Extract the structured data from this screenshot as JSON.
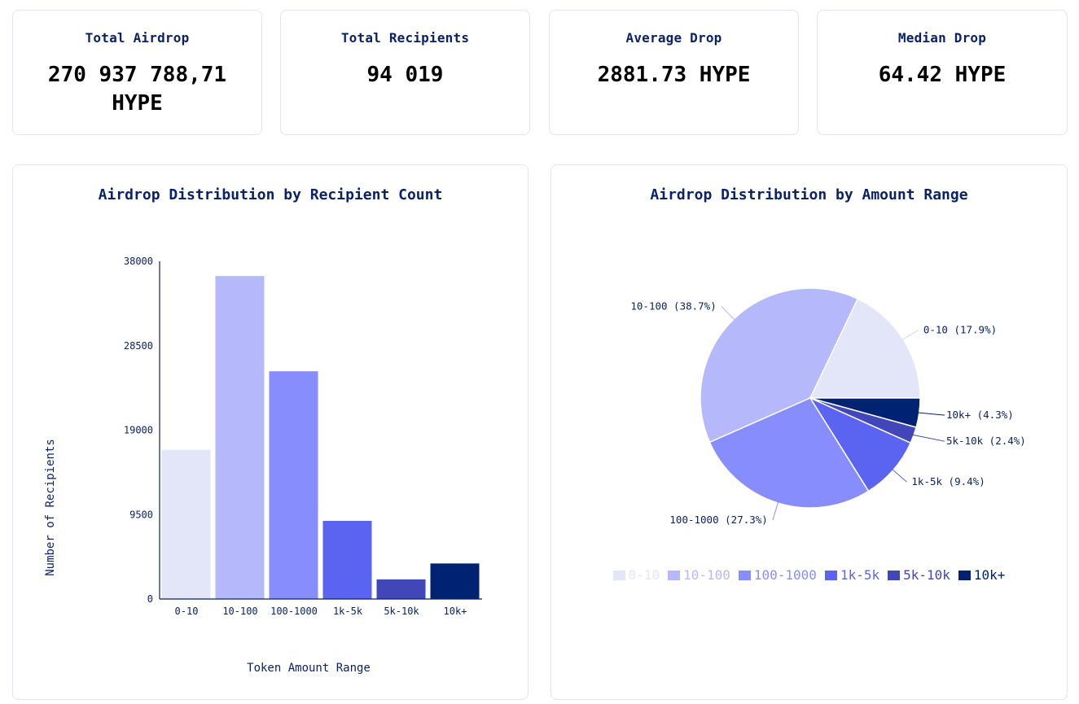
{
  "stats": [
    {
      "label": "Total Airdrop",
      "value": "270 937 788,71 HYPE"
    },
    {
      "label": "Total Recipients",
      "value": "94 019"
    },
    {
      "label": "Average Drop",
      "value": "2881.73 HYPE"
    },
    {
      "label": "Median Drop",
      "value": "64.42 HYPE"
    }
  ],
  "colors": [
    "#e3e5f8",
    "#b6b8fc",
    "#878dfc",
    "#5b64f1",
    "#4146b9",
    "#002272"
  ],
  "chart_data": [
    {
      "type": "bar",
      "title": "Airdrop Distribution by Recipient Count",
      "xlabel": "Token Amount Range",
      "ylabel": "Number of Recipients",
      "categories": [
        "0-10",
        "10-100",
        "100-1000",
        "1k-5k",
        "5k-10k",
        "10k+"
      ],
      "values": [
        16829,
        36385,
        25667,
        8838,
        2256,
        4043
      ],
      "ylim": [
        0,
        38000
      ],
      "yticks": [
        "0",
        "9500",
        "19000",
        "28500",
        "38000"
      ],
      "ytick_values": [
        0,
        9500,
        19000,
        28500,
        38000
      ],
      "grid": false
    },
    {
      "type": "pie",
      "title": "Airdrop Distribution by Amount Range",
      "categories": [
        "0-10",
        "10-100",
        "100-1000",
        "1k-5k",
        "5k-10k",
        "10k+"
      ],
      "values": [
        17.9,
        38.7,
        27.3,
        9.4,
        2.4,
        4.3
      ],
      "labels": [
        "0-10 (17.9%)",
        "10-100 (38.7%)",
        "100-1000 (27.3%)",
        "1k-5k (9.4%)",
        "5k-10k (2.4%)",
        "10k+ (4.3%)"
      ],
      "legend": [
        "0-10",
        "10-100",
        "100-1000",
        "1k-5k",
        "5k-10k",
        "10k+"
      ],
      "legend_position": "bottom"
    }
  ]
}
